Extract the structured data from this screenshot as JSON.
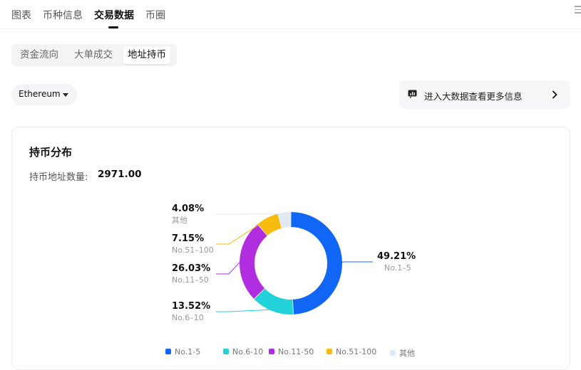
{
  "top_tabs": [
    "图表",
    "币种信息",
    "交易数据",
    "币圈"
  ],
  "active_top_tab": "交易数据",
  "sub_tabs": [
    "资金流向",
    "大单成交",
    "地址持币"
  ],
  "active_sub_tab": "地址持币",
  "chain_select": {
    "value": "Ethereum"
  },
  "bigdata_link": {
    "label": "进入大数据查看更多信息"
  },
  "card": {
    "title": "持币分布",
    "count_label": "持币地址数量:",
    "count_value": "2971.00"
  },
  "colors": {
    "No.1-5": "#1166f6",
    "No.6-10": "#21d3d8",
    "No.11-50": "#b12ee0",
    "No.51-100": "#f6bc10",
    "其他": "#e2e9f3"
  },
  "chart_data": {
    "type": "pie",
    "title": "持币分布",
    "labels": [
      "No.1-5",
      "No.6-10",
      "No.11-50",
      "No.51-100",
      "其他"
    ],
    "values": [
      49.21,
      13.52,
      26.03,
      7.15,
      4.08
    ],
    "value_labels": [
      "49.21%",
      "13.52%",
      "26.03%",
      "7.15%",
      "4.08%"
    ],
    "donut": true,
    "legend_position": "bottom"
  }
}
